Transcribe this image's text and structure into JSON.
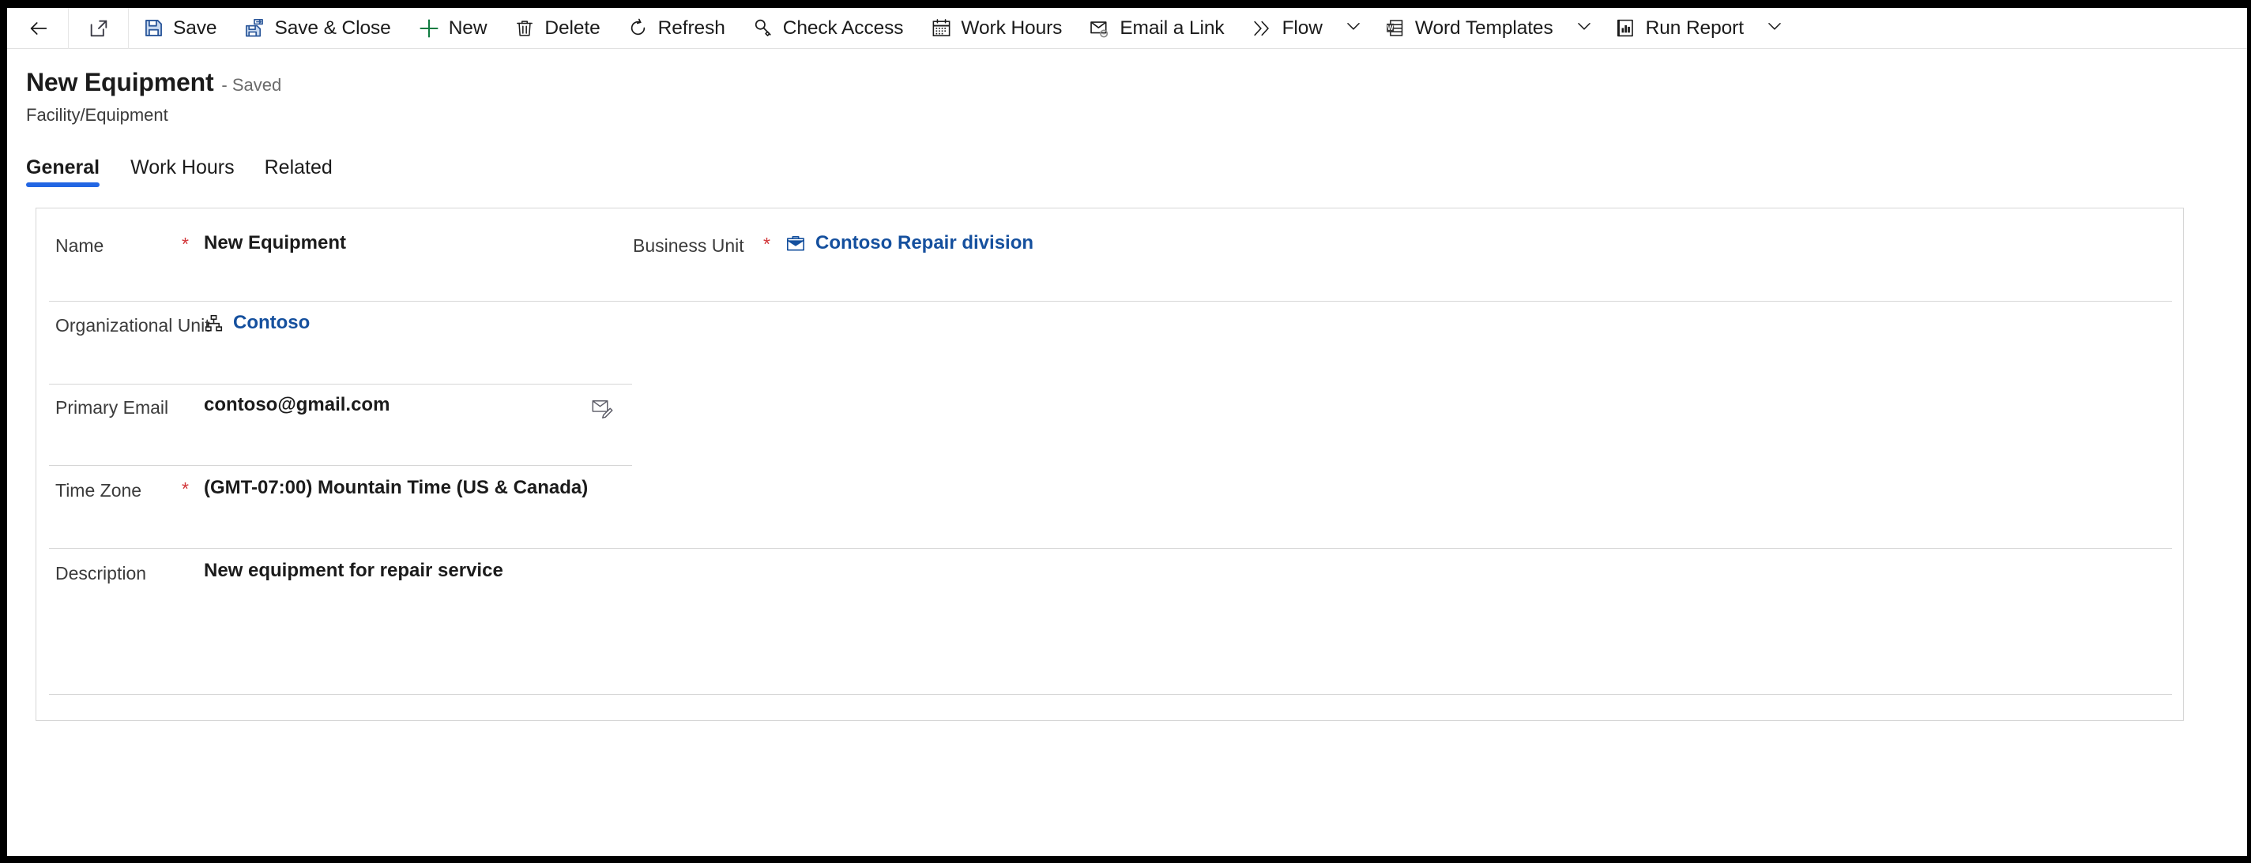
{
  "commandbar": {
    "back": {
      "name": "back-arrow-icon",
      "label": "Back"
    },
    "popout": {
      "name": "open-in-new-window-icon",
      "label": "Open in new window"
    },
    "items": [
      {
        "label": "Save",
        "icon": "save-icon"
      },
      {
        "label": "Save & Close",
        "icon": "save-and-close-icon"
      },
      {
        "label": "New",
        "icon": "plus-icon"
      },
      {
        "label": "Delete",
        "icon": "trash-icon"
      },
      {
        "label": "Refresh",
        "icon": "refresh-icon"
      },
      {
        "label": "Check Access",
        "icon": "key-icon"
      },
      {
        "label": "Work Hours",
        "icon": "calendar-icon"
      },
      {
        "label": "Email a Link",
        "icon": "email-link-icon"
      },
      {
        "label": "Flow",
        "icon": "flow-icon",
        "caret": true
      },
      {
        "label": "Word Templates",
        "icon": "word-template-icon",
        "caret": true
      },
      {
        "label": "Run Report",
        "icon": "run-report-icon",
        "caret": true
      }
    ]
  },
  "header": {
    "title": "New Equipment",
    "saved_status": "- Saved",
    "subtitle": "Facility/Equipment"
  },
  "tabs": [
    {
      "label": "General",
      "active": true
    },
    {
      "label": "Work Hours",
      "active": false
    },
    {
      "label": "Related",
      "active": false
    }
  ],
  "form": {
    "name": {
      "label": "Name",
      "required": "*",
      "value": "New Equipment"
    },
    "business_unit": {
      "label": "Business Unit",
      "required": "*",
      "value": "Contoso Repair division",
      "icon": "briefcase-icon"
    },
    "organizational_unit": {
      "label": "Organizational Unit",
      "value": "Contoso",
      "icon": "org-hierarchy-icon"
    },
    "primary_email": {
      "label": "Primary Email",
      "value": "contoso@gmail.com",
      "action_icon": "compose-email-icon"
    },
    "time_zone": {
      "label": "Time Zone",
      "required": "*",
      "value": "(GMT-07:00) Mountain Time (US & Canada)"
    },
    "description": {
      "label": "Description",
      "value": "New equipment for repair service"
    }
  },
  "colors": {
    "accent_blue": "#2266e3",
    "link_blue": "#15509e",
    "required_red": "#d13438",
    "text_primary": "#1b1b1b",
    "text_secondary": "#3b3b3b",
    "divider": "#d6d6d6"
  }
}
